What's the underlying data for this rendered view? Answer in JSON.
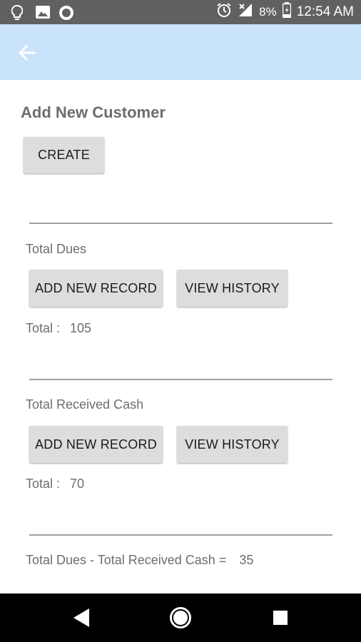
{
  "status_bar": {
    "battery_percent": "8%",
    "time": "12:54 AM",
    "left_icons": [
      "lightbulb-icon",
      "image-icon",
      "circle-icon"
    ],
    "right_icons": [
      "alarm-icon",
      "signal-icon",
      "battery-icon"
    ]
  },
  "toolbar": {
    "back_icon": "arrow-left-icon",
    "background": "#c9e3fb"
  },
  "main": {
    "title": "Add New Customer",
    "create_label": "CREATE",
    "dues": {
      "label": "Total Dues",
      "add_label": "ADD NEW RECORD",
      "history_label": "VIEW HISTORY",
      "total_label": "Total :",
      "total_value": "105"
    },
    "cash": {
      "label": "Total Received Cash",
      "add_label": "ADD NEW RECORD",
      "history_label": "VIEW HISTORY",
      "total_label": "Total :",
      "total_value": "70"
    },
    "summary_label": "Total Dues - Total Received Cash =",
    "summary_value": "35"
  },
  "nav_bar": {
    "buttons": [
      "back-triangle-icon",
      "home-circle-icon",
      "recents-square-icon"
    ]
  }
}
